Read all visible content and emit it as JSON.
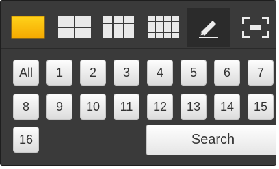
{
  "toolbar": {
    "tools": [
      {
        "name": "single-view-icon",
        "color": "#ffc000"
      },
      {
        "name": "quad-view-icon"
      },
      {
        "name": "nine-view-icon"
      },
      {
        "name": "sixteen-view-icon"
      },
      {
        "name": "pencil-icon",
        "active": true
      },
      {
        "name": "fullscreen-icon"
      }
    ]
  },
  "channels": {
    "all_label": "All",
    "numbers": [
      "1",
      "2",
      "3",
      "4",
      "5",
      "6",
      "7",
      "8",
      "9",
      "10",
      "11",
      "12",
      "13",
      "14",
      "15",
      "16"
    ]
  },
  "search": {
    "label": "Search"
  }
}
